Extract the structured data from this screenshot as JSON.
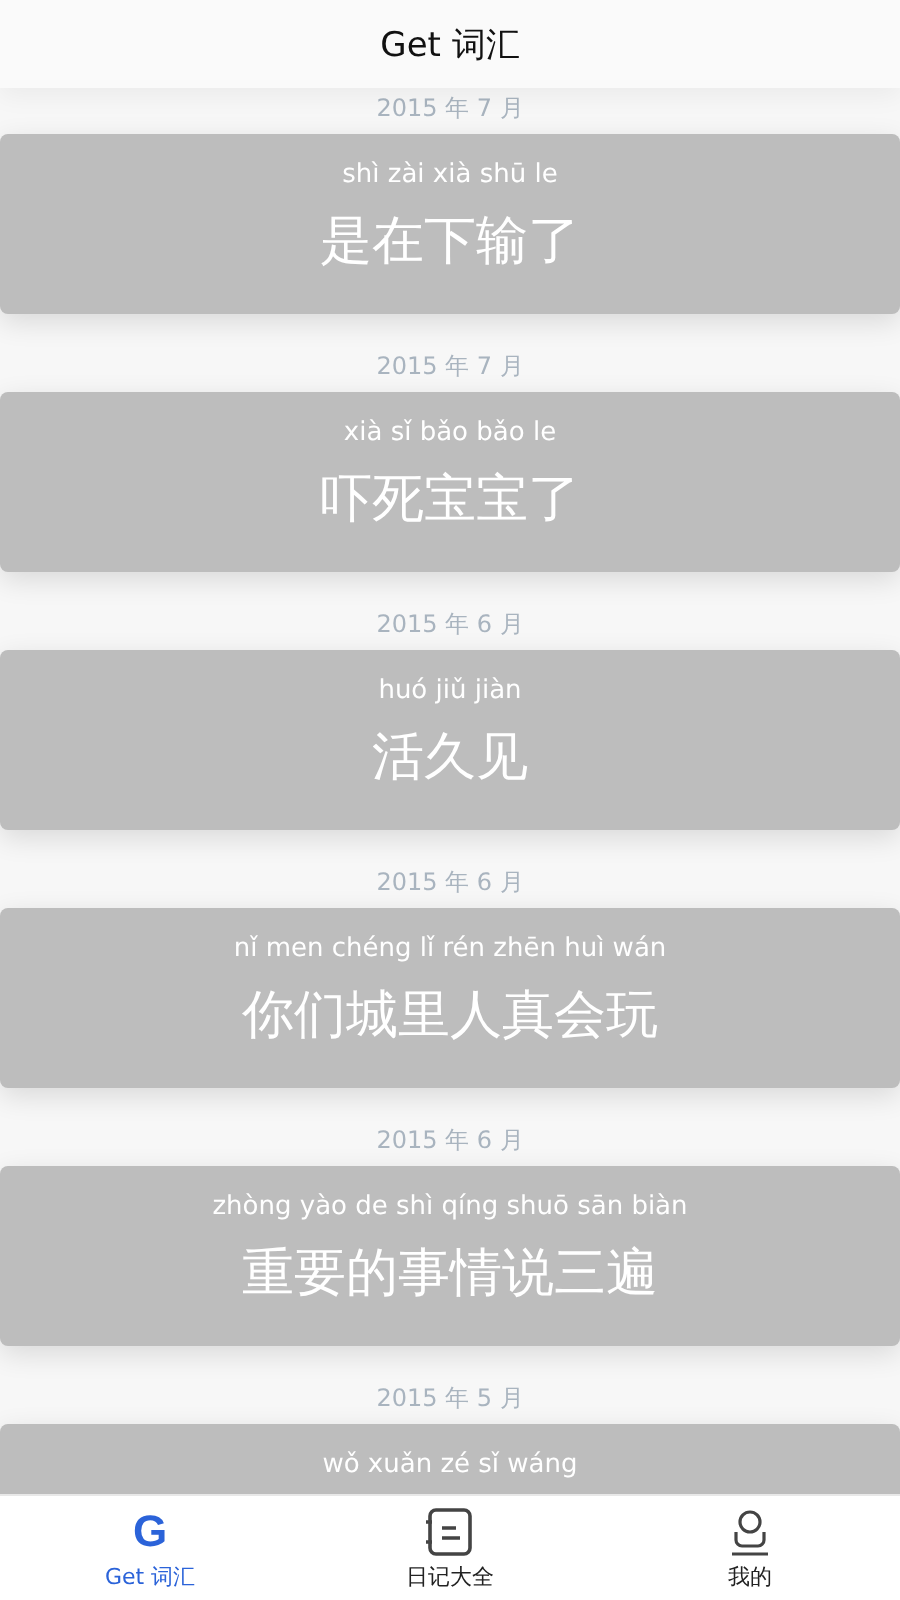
{
  "header": {
    "title": "Get 词汇"
  },
  "entries": [
    {
      "date": "2015 年 7 月",
      "pinyin": "shì zài xià shū le",
      "hanzi": "是在下输了"
    },
    {
      "date": "2015 年 7 月",
      "pinyin": "xià sǐ bǎo bǎo le",
      "hanzi": "吓死宝宝了"
    },
    {
      "date": "2015 年 6 月",
      "pinyin": "huó jiǔ jiàn",
      "hanzi": "活久见"
    },
    {
      "date": "2015 年 6 月",
      "pinyin": "nǐ men chéng lǐ rén zhēn huì wán",
      "hanzi": "你们城里人真会玩"
    },
    {
      "date": "2015 年 6 月",
      "pinyin": "zhòng yào de shì qíng shuō sān biàn",
      "hanzi": "重要的事情说三遍"
    },
    {
      "date": "2015 年 5 月",
      "pinyin": "wǒ xuǎn zé sǐ wáng"
    }
  ],
  "tabs": [
    {
      "kind": "letter",
      "icon": "G",
      "label": "Get 词汇",
      "selected": true
    },
    {
      "kind": "notebook",
      "label": "日记大全",
      "selected": false
    },
    {
      "kind": "person",
      "label": "我的",
      "selected": false
    }
  ]
}
